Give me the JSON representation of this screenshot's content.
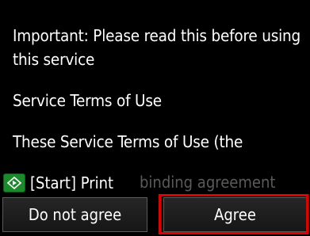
{
  "message": {
    "heading": "Important: Please read this before using this service",
    "title": "Service Terms of Use",
    "body_partial": "These Service Terms of Use (the"
  },
  "footer": {
    "start_icon": "diamond-start-icon",
    "start_label": "[Start] Print",
    "background_text": "binding agreement"
  },
  "buttons": {
    "disagree_label": "Do not agree",
    "agree_label": "Agree"
  },
  "colors": {
    "background": "#000000",
    "start_icon": "#1b8a2b",
    "highlight": "#e00000"
  }
}
